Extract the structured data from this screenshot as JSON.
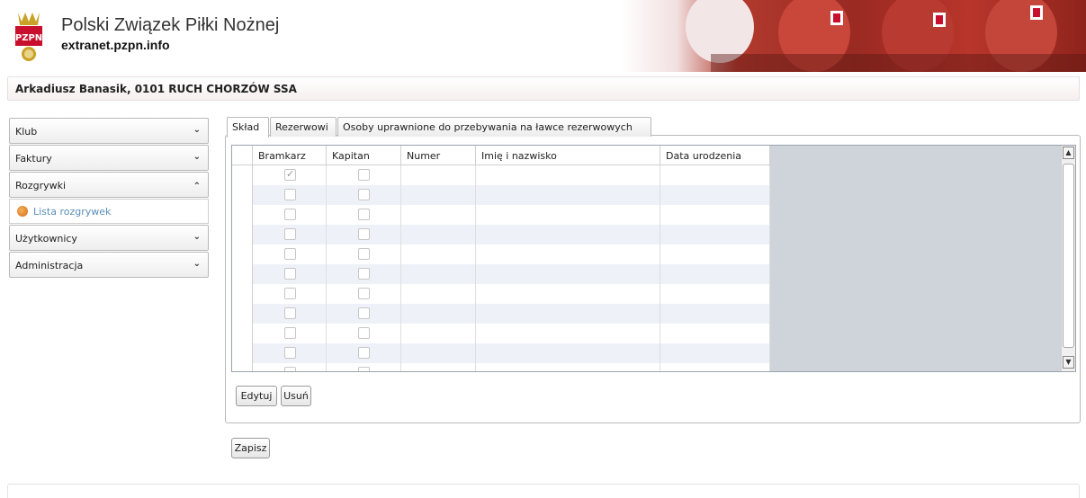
{
  "header": {
    "title": "Polski Związek Piłki Nożnej",
    "subtitle": "extranet.pzpn.info",
    "logo_text": "PZPN"
  },
  "userbar": {
    "text": "Arkadiusz Banasik, 0101 RUCH CHORZÓW SSA"
  },
  "sidebar": {
    "items": [
      {
        "label": "Klub",
        "expanded": false
      },
      {
        "label": "Faktury",
        "expanded": false
      },
      {
        "label": "Rozgrywki",
        "expanded": true,
        "children": [
          "Lista rozgrywek"
        ]
      },
      {
        "label": "Użytkownicy",
        "expanded": false
      },
      {
        "label": "Administracja",
        "expanded": false
      }
    ]
  },
  "tabs": [
    {
      "label": "Skład",
      "active": true
    },
    {
      "label": "Rezerwowi",
      "active": false
    },
    {
      "label": "Osoby uprawnione do przebywania na ławce rezerwowych",
      "active": false
    }
  ],
  "grid": {
    "columns": [
      "Bramkarz",
      "Kapitan",
      "Numer",
      "Imię i nazwisko",
      "Data urodzenia"
    ],
    "rows": [
      {
        "bramkarz": true,
        "kapitan": false
      },
      {
        "bramkarz": false,
        "kapitan": false
      },
      {
        "bramkarz": false,
        "kapitan": false
      },
      {
        "bramkarz": false,
        "kapitan": false
      },
      {
        "bramkarz": false,
        "kapitan": false
      },
      {
        "bramkarz": false,
        "kapitan": false
      },
      {
        "bramkarz": false,
        "kapitan": false
      },
      {
        "bramkarz": false,
        "kapitan": false
      },
      {
        "bramkarz": false,
        "kapitan": false
      },
      {
        "bramkarz": false,
        "kapitan": false
      },
      {
        "bramkarz": false,
        "kapitan": false
      }
    ]
  },
  "buttons": {
    "edit": "Edytuj",
    "delete": "Usuń",
    "save": "Zapisz"
  },
  "colors": {
    "grid_fill": "#cfd4db",
    "row_alt": "#eef2f8",
    "link": "#5a8fb8"
  },
  "icons": {
    "expand": "chevron-down-icon",
    "collapse": "chevron-up-icon",
    "scroll_up": "arrow-up-icon",
    "scroll_down": "arrow-down-icon"
  }
}
